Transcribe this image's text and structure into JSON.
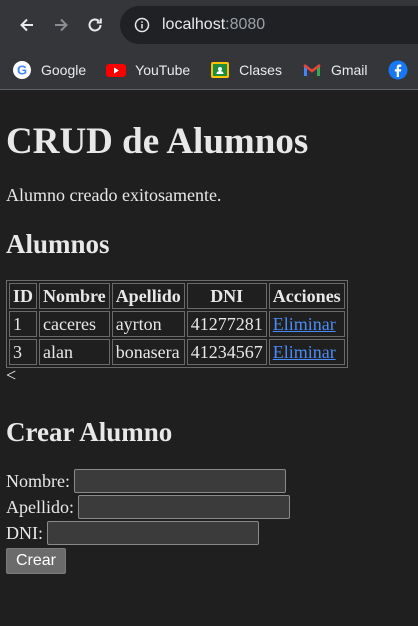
{
  "browser": {
    "url_host": "localhost",
    "url_port": ":8080",
    "bookmarks": [
      {
        "label": "Google",
        "icon": "google-icon"
      },
      {
        "label": "YouTube",
        "icon": "youtube-icon"
      },
      {
        "label": "Clases",
        "icon": "classroom-icon"
      },
      {
        "label": "Gmail",
        "icon": "gmail-icon"
      }
    ]
  },
  "page": {
    "title": "CRUD de Alumnos",
    "message": "Alumno creado exitosamente.",
    "list_heading": "Alumnos",
    "table": {
      "headers": [
        "ID",
        "Nombre",
        "Apellido",
        "DNI",
        "Acciones"
      ],
      "rows": [
        {
          "id": "1",
          "nombre": "caceres",
          "apellido": "ayrton",
          "dni": "41277281",
          "accion": "Eliminar"
        },
        {
          "id": "3",
          "nombre": "alan",
          "apellido": "bonasera",
          "dni": "41234567",
          "accion": "Eliminar"
        }
      ]
    },
    "stray_text": "<",
    "create_heading": "Crear Alumno",
    "form": {
      "nombre_label": "Nombre:",
      "nombre_value": "",
      "apellido_label": "Apellido:",
      "apellido_value": "",
      "dni_label": "DNI:",
      "dni_value": "",
      "submit_label": "Crear"
    }
  }
}
